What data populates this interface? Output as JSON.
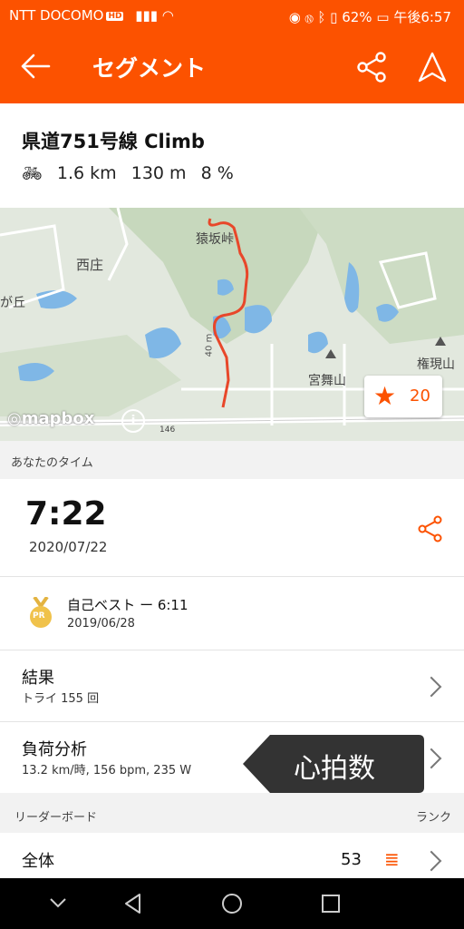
{
  "status_bar": {
    "carrier": "NTT DOCOMO",
    "carrier_badge": "HD",
    "battery": "62%",
    "time": "午後6:57"
  },
  "app_bar": {
    "title": "セグメント",
    "back_icon": "arrow-left-icon",
    "share_icon": "share-icon",
    "navigate_icon": "navigation-arrow-icon"
  },
  "segment": {
    "name": "県道751号線 Climb",
    "distance": "1.6 km",
    "elevation": "130 m",
    "grade": "8 %"
  },
  "map": {
    "labels": [
      "猿坂峠",
      "西庄",
      "が丘",
      "宮舞山",
      "権現山",
      "146"
    ],
    "elevation_label": "40 m",
    "attribution": "mapbox",
    "star_count": "20"
  },
  "your_time": {
    "section_label": "あなたのタイム",
    "time": "7:22",
    "date": "2020/07/22"
  },
  "pr": {
    "badge": "PR",
    "label": "自己ベスト ー 6:11",
    "date": "2019/06/28"
  },
  "results": {
    "title": "結果",
    "sub": "トライ 155 回"
  },
  "load": {
    "title": "負荷分析",
    "sub": "13.2 km/時, 156 bpm, 235 W",
    "tooltip": "心拍数"
  },
  "leaderboard": {
    "section_label": "リーダーボード",
    "rank_label": "ランク",
    "overall_label": "全体",
    "overall_rank": "53"
  },
  "colors": {
    "brand": "#fc5200",
    "route": "#e8472a"
  }
}
